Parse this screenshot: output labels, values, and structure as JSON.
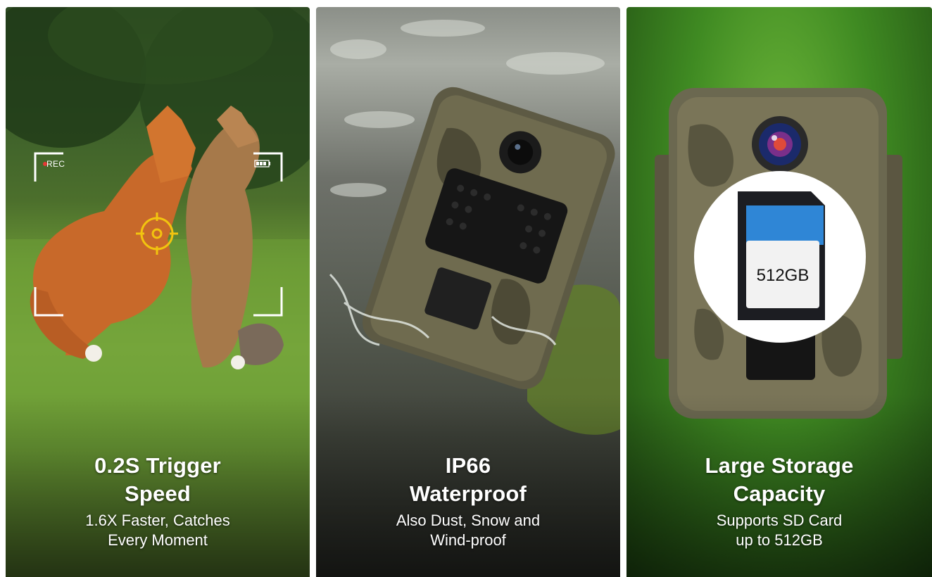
{
  "panels": [
    {
      "title_line1": "0.2S Trigger",
      "title_line2": "Speed",
      "subtitle_line1": "1.6X Faster, Catches",
      "subtitle_line2": "Every Moment",
      "overlay_text": "REC"
    },
    {
      "title_line1": "IP66",
      "title_line2": "Waterproof",
      "subtitle_line1": "Also Dust, Snow and",
      "subtitle_line2": "Wind-proof"
    },
    {
      "title_line1": "Large Storage",
      "title_line2": "Capacity",
      "subtitle_line1": "Supports SD Card",
      "subtitle_line2": "up to 512GB",
      "sd_card_label": "512GB"
    }
  ],
  "colors": {
    "focus_reticle": "#f2c40f",
    "rec_dot": "#e53935",
    "sd_card_stripe": "#2f86d6"
  },
  "icons": [
    "viewfinder-corner-icon",
    "rec-dot-icon",
    "battery-icon",
    "focus-target-icon",
    "sd-card-icon"
  ]
}
